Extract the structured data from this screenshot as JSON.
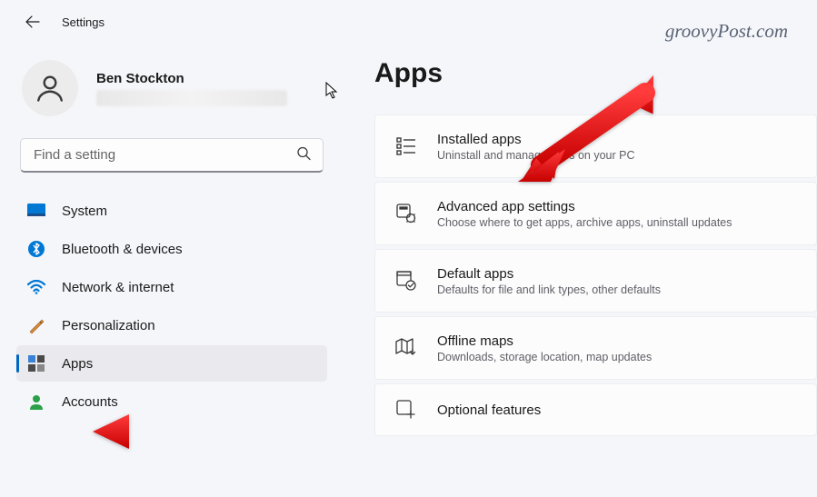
{
  "window": {
    "title": "Settings",
    "watermark": "groovyPost.com"
  },
  "profile": {
    "name": "Ben Stockton"
  },
  "search": {
    "placeholder": "Find a setting"
  },
  "sidebar": {
    "items": [
      {
        "id": "system",
        "label": "System"
      },
      {
        "id": "bluetooth",
        "label": "Bluetooth & devices"
      },
      {
        "id": "network",
        "label": "Network & internet"
      },
      {
        "id": "personalization",
        "label": "Personalization"
      },
      {
        "id": "apps",
        "label": "Apps",
        "active": true
      },
      {
        "id": "accounts",
        "label": "Accounts"
      }
    ]
  },
  "page": {
    "title": "Apps"
  },
  "cards": [
    {
      "id": "installed",
      "title": "Installed apps",
      "subtitle": "Uninstall and manage apps on your PC"
    },
    {
      "id": "advanced",
      "title": "Advanced app settings",
      "subtitle": "Choose where to get apps, archive apps, uninstall updates"
    },
    {
      "id": "default",
      "title": "Default apps",
      "subtitle": "Defaults for file and link types, other defaults"
    },
    {
      "id": "offline-maps",
      "title": "Offline maps",
      "subtitle": "Downloads, storage location, map updates"
    },
    {
      "id": "optional",
      "title": "Optional features",
      "subtitle": ""
    }
  ]
}
